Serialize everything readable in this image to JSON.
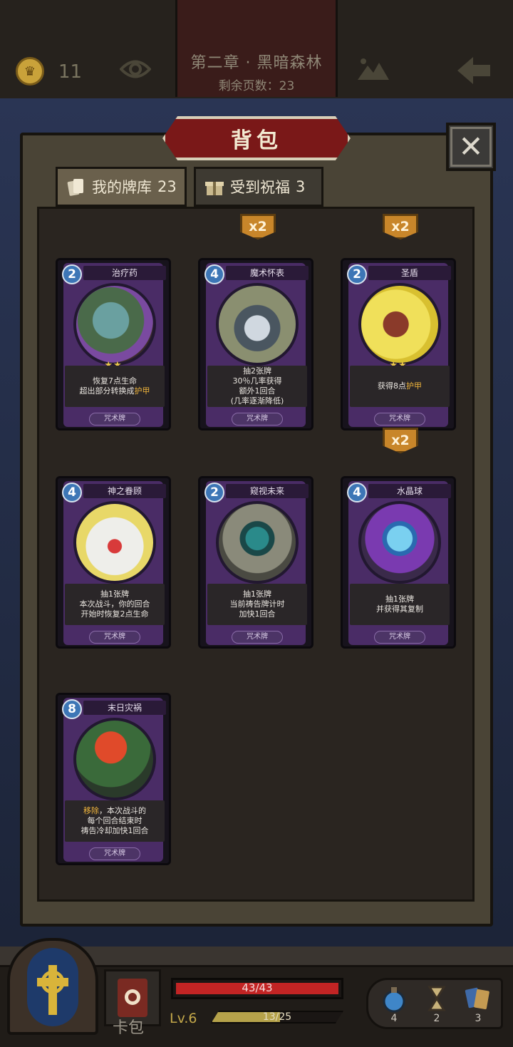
{
  "topbar": {
    "coins": "11",
    "chapter_title": "第二章 · 黑暗森林",
    "pages_left": "剩余页数：23"
  },
  "panel": {
    "title": "背包",
    "close_label": "✕",
    "tabs": [
      {
        "label": "我的牌库",
        "count": "23"
      },
      {
        "label": "受到祝福",
        "count": "3"
      }
    ]
  },
  "cards": [
    {
      "cost": "2",
      "name": "治疗药",
      "stars": "★★",
      "desc": [
        "恢复7点生命",
        "超出部分转换成护甲"
      ],
      "type": "咒术牌",
      "badge": "x2"
    },
    {
      "cost": "4",
      "name": "魔术怀表",
      "stars": "",
      "desc": [
        "抽2张牌",
        "30％几率获得",
        "额外1回合",
        "(几率逐渐降低)"
      ],
      "type": "咒术牌",
      "badge": "x2"
    },
    {
      "cost": "2",
      "name": "圣盾",
      "stars": "★★",
      "desc": [
        "获得8点护甲"
      ],
      "type": "咒术牌",
      "badge": "x2"
    },
    {
      "cost": "4",
      "name": "神之眷顾",
      "stars": "",
      "desc": [
        "抽1张牌",
        "本次战斗，你的回合",
        "开始时恢复2点生命"
      ],
      "type": "咒术牌",
      "badge": ""
    },
    {
      "cost": "2",
      "name": "窥视未来",
      "stars": "",
      "desc": [
        "抽1张牌",
        "当前祷告牌计时",
        "加快1回合"
      ],
      "type": "咒术牌",
      "badge": ""
    },
    {
      "cost": "4",
      "name": "水晶球",
      "stars": "",
      "desc": [
        "抽1张牌",
        "并获得其复制"
      ],
      "type": "咒术牌",
      "badge": ""
    },
    {
      "cost": "8",
      "name": "末日灾祸",
      "stars": "",
      "desc": [
        "移除，本次战斗的",
        "每个回合结束时",
        "祷告冷却加快1回合"
      ],
      "type": "咒术牌",
      "badge": ""
    }
  ],
  "bottombar": {
    "deck_label": "卡包",
    "hp_text": "43/43",
    "hp_fraction": 1.0,
    "level": "Lv.6",
    "xp_text": "13/25",
    "xp_fraction": 0.52,
    "items": [
      {
        "icon": "potion-icon",
        "count": "4"
      },
      {
        "icon": "hourglass-icon",
        "count": "2"
      },
      {
        "icon": "cards-icon",
        "count": "3"
      }
    ]
  }
}
